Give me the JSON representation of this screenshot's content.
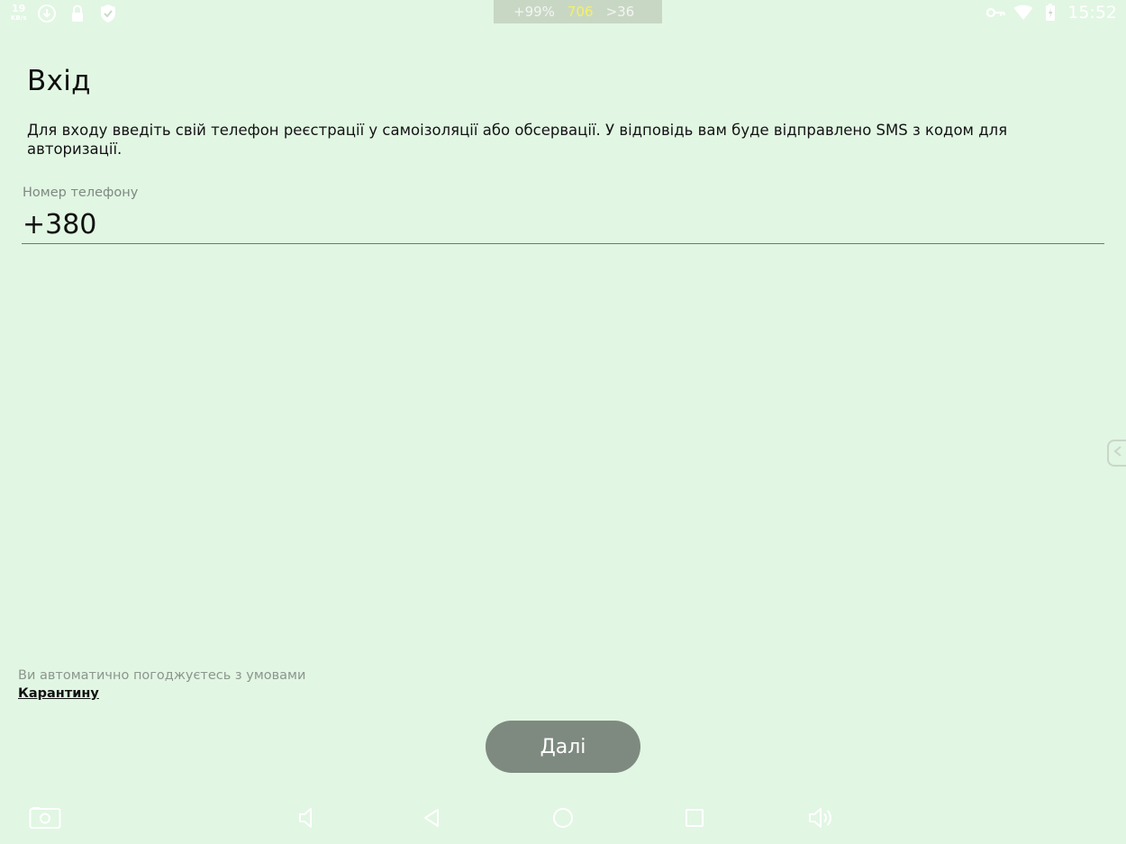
{
  "status_bar": {
    "network_speed": "19",
    "network_unit": "KB/s",
    "perf_overlay": [
      "+99%",
      "706",
      ">36"
    ],
    "time": "15:52",
    "icons": [
      "network-speed-icon",
      "download-icon",
      "lock-icon",
      "shield-check-icon",
      "vpn-key-icon",
      "wifi-icon",
      "battery-icon"
    ]
  },
  "login": {
    "title": "Вхід",
    "description": "Для входу введіть свій телефон реєстрації у самоізоляції або обсервації. У відповідь вам буде відправлено SMS з кодом для авторизації.",
    "phone_label": "Номер телефону",
    "phone_value": "+380"
  },
  "terms": {
    "text": "Ви автоматично погоджуєтесь з умовами",
    "link": "Карантину"
  },
  "actions": {
    "next_label": "Далі"
  },
  "nav_bar": {
    "icons": [
      "screenshot-icon",
      "volume-down-icon",
      "back-icon",
      "home-icon",
      "recents-icon",
      "volume-up-icon"
    ]
  },
  "colors": {
    "background": "#e1f6e3",
    "button": "#7e8a80",
    "label": "#7e8a80"
  }
}
